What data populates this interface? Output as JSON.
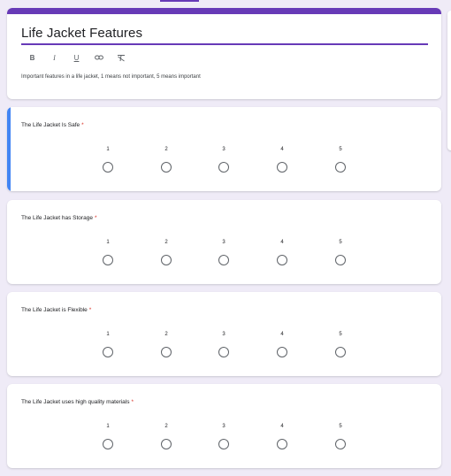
{
  "form": {
    "title": "Life Jacket Features",
    "description": "Important features in a life jacket, 1 means not important, 5 means important",
    "toolbar": [
      {
        "name": "bold-button",
        "glyph": "B",
        "icon": "bold-icon"
      },
      {
        "name": "italic-button",
        "glyph": "I",
        "icon": "italic-icon"
      },
      {
        "name": "underline-button",
        "glyph": "U",
        "icon": "underline-icon"
      },
      {
        "name": "link-button",
        "glyph": "",
        "icon": "link-icon"
      },
      {
        "name": "clear-format-button",
        "glyph": "",
        "icon": "clear-format-icon"
      }
    ]
  },
  "scale_labels": [
    "1",
    "2",
    "3",
    "4",
    "5"
  ],
  "questions": [
    {
      "title": "The Life Jacket Is Safe",
      "required_mark": "*",
      "active": true
    },
    {
      "title": "The Life Jacket has Storage",
      "required_mark": "*",
      "active": false
    },
    {
      "title": "The Life Jacket is Flexible",
      "required_mark": "*",
      "active": false
    },
    {
      "title": "The Life Jacket uses high quality materials",
      "required_mark": "*",
      "active": false
    }
  ],
  "colors": {
    "theme": "#673ab7",
    "active_accent": "#4285f4",
    "required": "#d93025",
    "background": "#efebf7"
  }
}
